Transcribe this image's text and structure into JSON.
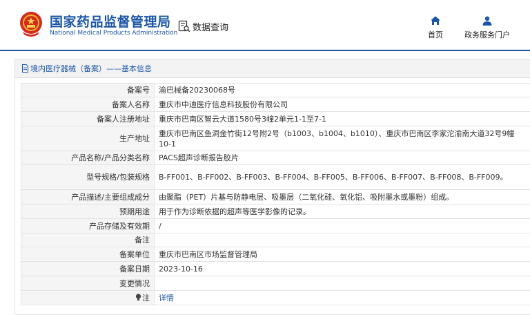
{
  "header": {
    "site_name": "国家药品监督管理局",
    "site_name_en": "National Medical Products Administration",
    "query_label": "数据查询",
    "nav": [
      {
        "label": "首页",
        "icon": "home-icon"
      },
      {
        "label": "政务服务门户",
        "icon": "user-icon"
      }
    ],
    "brand_color": "#1b56a6"
  },
  "panel": {
    "breadcrumb": "境内医疗器械（备案）——基本信息"
  },
  "record": {
    "rows": [
      {
        "label": "备案号",
        "value": "渝巴械备20230068号"
      },
      {
        "label": "备案人名称",
        "value": "重庆市中迪医疗信息科技股份有限公司"
      },
      {
        "label": "备案人注册地址",
        "value": "重庆市巴南区智云大道1580号3幢2单元1-1至7-1"
      },
      {
        "label": "生产地址",
        "value": "重庆市巴南区鱼洞金竹街12号附2号（b1003、b1004、b1010）、重庆市巴南区李家沱渝南大道32号9幢10-1"
      },
      {
        "label": "产品名称/产品分类名称",
        "value": "PACS超声诊断报告胶片"
      },
      {
        "label": "型号规格/包装规格",
        "value": "B-FF001、B-FF002、B-FF003、B-FF004、B-FF005、B-FF006、B-FF007、B-FF008、B-FF009。"
      },
      {
        "label": "产品描述/主要组成成分",
        "value": "由聚酯（PET）片基与防静电层、吸墨层（二氧化硅、氧化铝、吸附墨水或墨粉）组成。"
      },
      {
        "label": "预期用途",
        "value": "用于作为诊断依据的超声等医学影像的记录。"
      },
      {
        "label": "产品存储及有效期",
        "value": "/"
      },
      {
        "label": "备注",
        "value": ""
      },
      {
        "label": "备案单位",
        "value": "重庆市巴南区市场监督管理局"
      },
      {
        "label": "备案日期",
        "value": "2023-10-16"
      },
      {
        "label": "变更情况",
        "value": ""
      },
      {
        "label": "注",
        "value": "详情"
      }
    ]
  }
}
